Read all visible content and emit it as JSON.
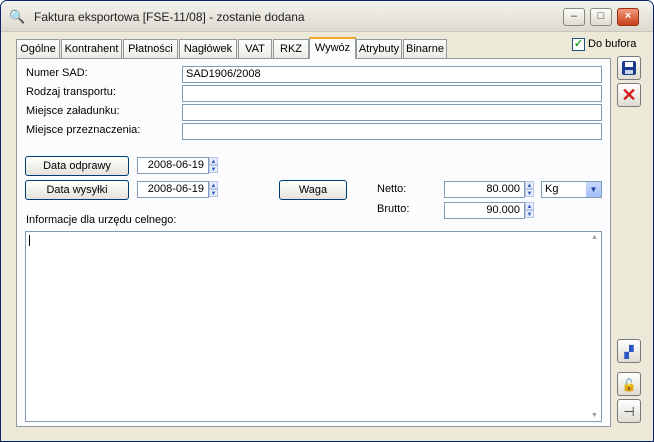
{
  "window": {
    "title": "Faktura eksportowa [FSE-11/08]  - zostanie dodana",
    "minimize_label": "–",
    "maximize_label": "□",
    "close_label": "×"
  },
  "tabs": [
    {
      "label": "Ogólne"
    },
    {
      "label": "Kontrahent"
    },
    {
      "label": "Płatności"
    },
    {
      "label": "Nagłówek"
    },
    {
      "label": "VAT"
    },
    {
      "label": "RKZ"
    },
    {
      "label": "Wywóz",
      "active": true
    },
    {
      "label": "Atrybuty"
    },
    {
      "label": "Binarne"
    }
  ],
  "do_bufora": {
    "label": "Do bufora",
    "checked": true
  },
  "form": {
    "numer_sad": {
      "label": "Numer SAD:",
      "value": "SAD1906/2008"
    },
    "rodzaj_transportu": {
      "label": "Rodzaj transportu:",
      "value": ""
    },
    "miejsce_zaladunku": {
      "label": "Miejsce załadunku:",
      "value": ""
    },
    "miejsce_przeznaczenia": {
      "label": "Miejsce przeznaczenia:",
      "value": ""
    },
    "data_odprawy": {
      "button": "Data odprawy",
      "value": "2008-06-19"
    },
    "data_wysylki": {
      "button": "Data wysyłki",
      "value": "2008-06-19"
    },
    "waga_button": "Waga",
    "netto": {
      "label": "Netto:",
      "value": "80.000"
    },
    "brutto": {
      "label": "Brutto:",
      "value": "90.000"
    },
    "unit": "Kg",
    "informacje": {
      "label": "Informacje dla urzędu celnego:",
      "value": ""
    }
  },
  "side_icons": [
    "save-icon",
    "cancel-icon",
    "chart-icon",
    "lock-icon",
    "pin-icon"
  ],
  "colors": {
    "active_tab_accent": "#f6a52a",
    "cancel_red": "#d01c1c",
    "save_blue": "#1a3c8c"
  }
}
